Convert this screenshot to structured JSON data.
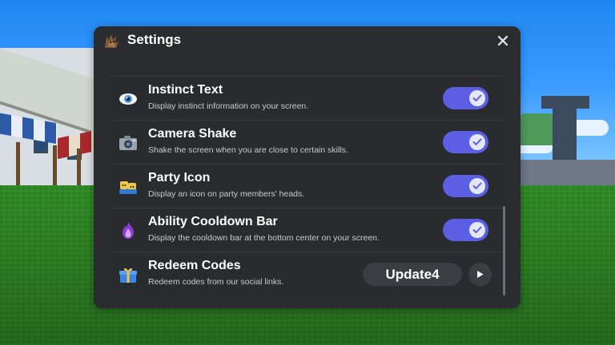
{
  "window": {
    "title": "Settings",
    "close_glyph": "✕"
  },
  "settings": [
    {
      "title": "Instinct Text",
      "description": "Display instinct information on your screen.",
      "icon": "eye-icon",
      "enabled": true
    },
    {
      "title": "Camera Shake",
      "description": "Shake the screen when you are close to certain skills.",
      "icon": "camera-icon",
      "enabled": true
    },
    {
      "title": "Party Icon",
      "description": "Display an icon on party members' heads.",
      "icon": "party-icon",
      "enabled": true
    },
    {
      "title": "Ability Cooldown Bar",
      "description": "Display the cooldown bar at the bottom center on your screen.",
      "icon": "flame-icon",
      "enabled": true
    }
  ],
  "redeem": {
    "title": "Redeem Codes",
    "description": "Redeem codes from our social links.",
    "icon": "gift-icon",
    "code_value": "Update4"
  },
  "colors": {
    "panel_bg": "#2b2c30",
    "toggle_on": "#5c5fe3",
    "pill_bg": "#3c3d42"
  }
}
